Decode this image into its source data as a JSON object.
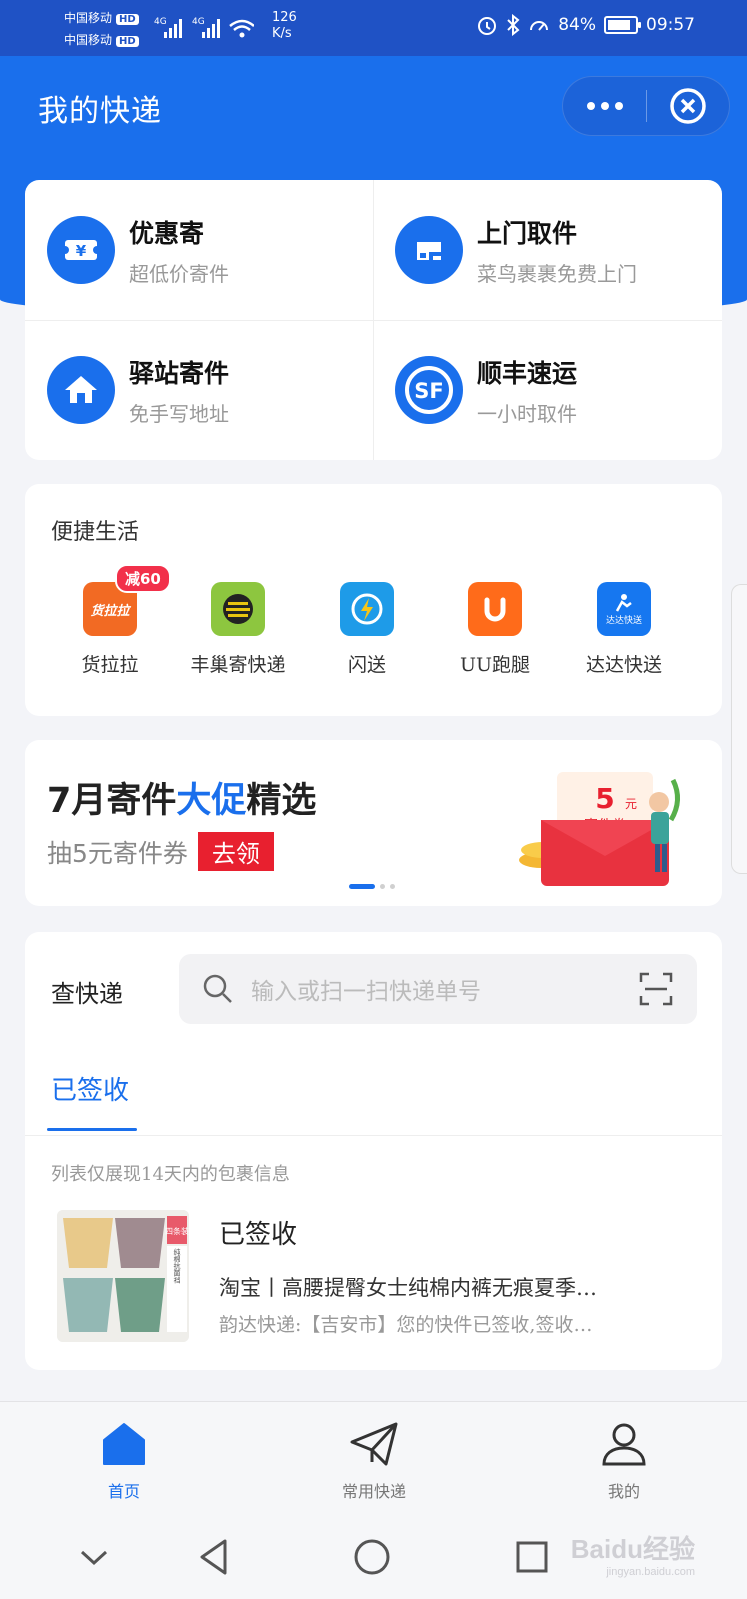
{
  "status_bar": {
    "carrier1": "中国移动",
    "carrier2": "中国移动",
    "hd": "HD",
    "speed_value": "126",
    "speed_unit": "K/s",
    "battery": "84%",
    "battery_level": 0.84,
    "time": "09:57"
  },
  "header": {
    "title": "我的快递"
  },
  "services": [
    {
      "title": "优惠寄",
      "subtitle": "超低价寄件",
      "icon": "ticket-yen-icon"
    },
    {
      "title": "上门取件",
      "subtitle": "菜鸟裹裹免费上门",
      "icon": "pickup-icon"
    },
    {
      "title": "驿站寄件",
      "subtitle": "免手写地址",
      "icon": "house-icon"
    },
    {
      "title": "顺丰速运",
      "subtitle": "一小时取件",
      "icon": "sf-logo-icon"
    }
  ],
  "life": {
    "title": "便捷生活",
    "items": [
      {
        "label": "货拉拉",
        "badge": "减60",
        "logo": "货拉拉",
        "color": "#f26a23"
      },
      {
        "label": "丰巢寄快递",
        "color": "#8dc63f"
      },
      {
        "label": "闪送",
        "color": "#1e9be8"
      },
      {
        "label": "UU跑腿",
        "color": "#ff6b1a"
      },
      {
        "label": "达达快送",
        "logo": "达达快送",
        "color": "#1677f0"
      }
    ]
  },
  "promo": {
    "title_a": "7月寄件",
    "title_hl": "大促",
    "title_b": "精选",
    "subtitle": "抽5元寄件券",
    "button": "去领",
    "coupon_amount": "5",
    "coupon_unit": "元",
    "coupon_label": "寄件券",
    "active_slide": 1
  },
  "tracking": {
    "label": "查快递",
    "placeholder": "输入或扫一扫快递单号",
    "tab": "已签收",
    "note": "列表仅展现14天内的包裹信息",
    "package": {
      "status": "已签收",
      "title": "淘宝丨高腰提臀女士纯棉内裤无痕夏季…",
      "desc": "韵达快递:【吉安市】您的快件已签收,签收…",
      "tag_a": "四条装",
      "tag_b": "纯棉抗菌裆"
    }
  },
  "tabbar": [
    {
      "label": "首页",
      "active": true
    },
    {
      "label": "常用快递",
      "active": false
    },
    {
      "label": "我的",
      "active": false
    }
  ],
  "watermark": {
    "text": "Baidu经验",
    "sub": "jingyan.baidu.com"
  },
  "colors": {
    "primary": "#1a6fec",
    "status_bar": "#1f52c5",
    "promo_red": "#e8202f"
  }
}
